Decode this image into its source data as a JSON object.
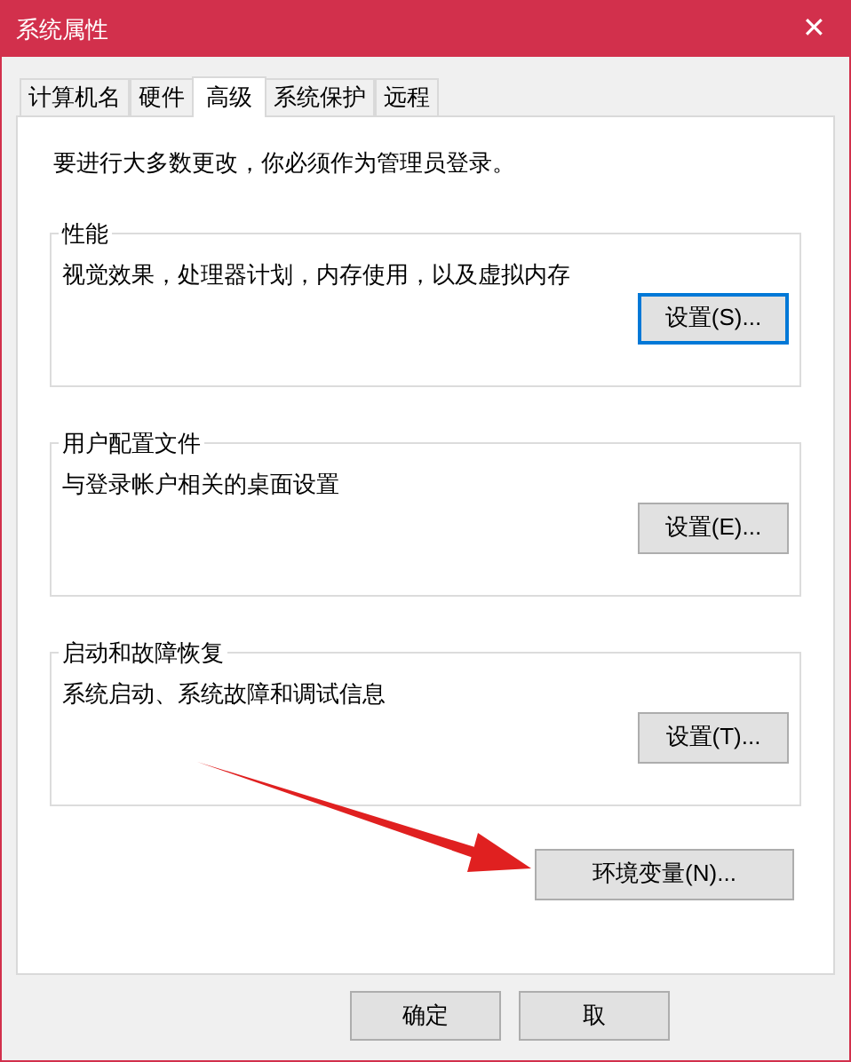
{
  "window": {
    "title": "系统属性",
    "close": "✕"
  },
  "tabs": [
    {
      "label": "计算机名",
      "selected": false
    },
    {
      "label": "硬件",
      "selected": false
    },
    {
      "label": "高级",
      "selected": true
    },
    {
      "label": "系统保护",
      "selected": false
    },
    {
      "label": "远程",
      "selected": false
    }
  ],
  "notice": "要进行大多数更改，你必须作为管理员登录。",
  "groups": [
    {
      "title": "性能",
      "description": "视觉效果，处理器计划，内存使用，以及虚拟内存",
      "button": "设置(S)...",
      "focused": true
    },
    {
      "title": "用户配置文件",
      "description": "与登录帐户相关的桌面设置",
      "button": "设置(E)...",
      "focused": false
    },
    {
      "title": "启动和故障恢复",
      "description": "系统启动、系统故障和调试信息",
      "button": "设置(T)...",
      "focused": false
    }
  ],
  "env_button": "环境变量(N)...",
  "buttons": [
    "确定",
    "取"
  ]
}
